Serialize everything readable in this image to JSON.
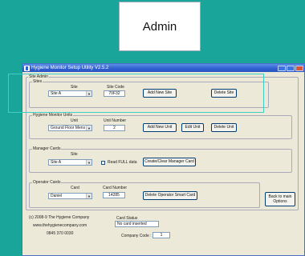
{
  "admin_label": "Admin",
  "window": {
    "title": "Hygiene Monitor Setup Utility   V2.5.2"
  },
  "site_admin": {
    "legend": "Site Admin",
    "sites": {
      "legend": "Sites",
      "site_label": "Site",
      "site_value": "Site A",
      "code_label": "Site Code",
      "code_value": "70F32",
      "add_button": "Add New Site",
      "delete_button": "Delete Site"
    },
    "units": {
      "legend": "Hygiene Monitor Units",
      "unit_label": "Unit",
      "unit_value": "Ground Floor Mens",
      "number_label": "Unit Number",
      "number_value": "2",
      "add_button": "Add New Unit",
      "edit_button": "Edit Unit",
      "delete_button": "Delete Unit"
    },
    "manager": {
      "legend": "Manager Cards",
      "site_label": "Site",
      "site_value": "Site A",
      "checkbox_label": "Read FULL data",
      "create_button": "Create/Clear Manager Card"
    },
    "operator": {
      "legend": "Operator Cards",
      "card_label": "Card",
      "card_value": "Daniel",
      "number_label": "Card Number",
      "number_value": "14285",
      "delete_button": "Delete Operator Smart  Card"
    },
    "back_button": "Back to main Options"
  },
  "footer": {
    "copyright": "(c) 2008-9 The Hygiene Company",
    "website": "www.thehygienecompany.com",
    "phone": "0845 370 0030",
    "card_status_label": "Card Status",
    "card_status_value": "No card inserted",
    "company_code_label": "Company Code :",
    "company_code_value": "1"
  }
}
